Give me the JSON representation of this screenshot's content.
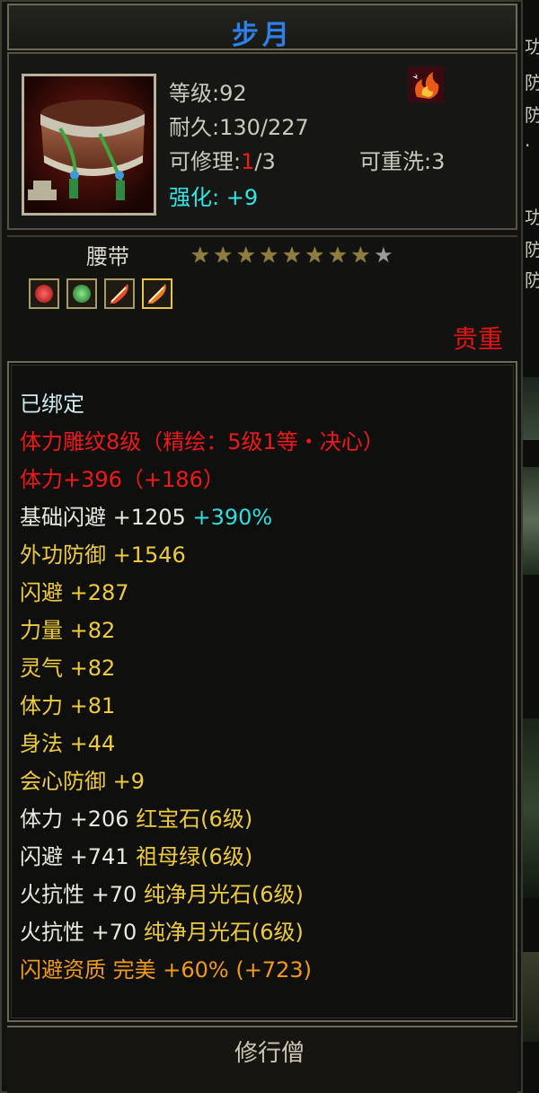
{
  "item": {
    "name": "步月",
    "icon": "belt-item-icon",
    "status_icon": "flame-buff-icon",
    "level": "等级:92",
    "durability": "耐久:130/227",
    "repair_label": "可修理:",
    "repair_used": "1",
    "repair_total": "/3",
    "rewash": "可重洗:3",
    "enhance_label": "强化:",
    "enhance_value": "+9",
    "type": "腰带",
    "stars_on": 8,
    "stars_total": 9,
    "gems": [
      "red-gem-icon",
      "green-gem-icon",
      "feather-gem-icon",
      "feather-gem-gold-icon"
    ],
    "rarity": "贵重"
  },
  "attributes": {
    "bound": "已绑定",
    "engrave": "体力雕纹8级（精绘：5级1等・决心）",
    "stamina_main": "体力+396（+186）",
    "base_dodge_a": "基础闪避 +1205 ",
    "base_dodge_b": "+390%",
    "outer_defense": "外功防御 +1546",
    "dodge": "闪避 +287",
    "strength": "力量 +82",
    "spirit": "灵气 +82",
    "stamina": "体力 +81",
    "agility": "身法 +44",
    "crit_defense": "会心防御 +9",
    "gem1_a": "体力 +206 ",
    "gem1_b": "红宝石(6级)",
    "gem2_a": "闪避 +741 ",
    "gem2_b": "祖母绿(6级)",
    "gem3_a": "火抗性 +70 ",
    "gem3_b": "纯净月光石(6级)",
    "gem4_a": "火抗性 +70 ",
    "gem4_b": "纯净月光石(6级)",
    "aptitude": "闪避资质 完美 +60% (+723)"
  },
  "footer": {
    "class_label": "修行僧"
  },
  "right_strip": [
    "功",
    "防",
    "防",
    "·",
    "功",
    "防",
    "防"
  ],
  "colors": {
    "title": "#2f7fe8",
    "red": "#ee1a1a",
    "yellow": "#eecb3c",
    "orange": "#f09a18",
    "cyan": "#2fdede"
  }
}
